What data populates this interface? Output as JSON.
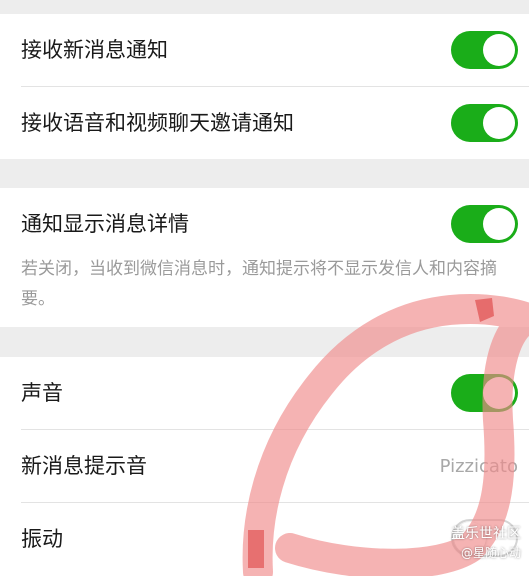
{
  "group1": {
    "receive_new_message_label": "接收新消息通知",
    "receive_new_message_on": true,
    "voice_video_invite_label": "接收语音和视频聊天邀请通知",
    "voice_video_invite_on": true
  },
  "group2": {
    "show_details_label": "通知显示消息详情",
    "show_details_on": true,
    "show_details_desc": "若关闭，当收到微信消息时，通知提示将不显示发信人和内容摘要。"
  },
  "group3": {
    "sound_label": "声音",
    "sound_on": true,
    "ringtone_label": "新消息提示音",
    "ringtone_value": "Pizzicato",
    "vibrate_label": "振动",
    "vibrate_on": false
  },
  "watermark": {
    "line1": "盖乐世社区",
    "line2": "@星随心动"
  },
  "colors": {
    "toggle_on": "#1aad19",
    "background": "#ededed",
    "annotation": "#f08b8b"
  }
}
